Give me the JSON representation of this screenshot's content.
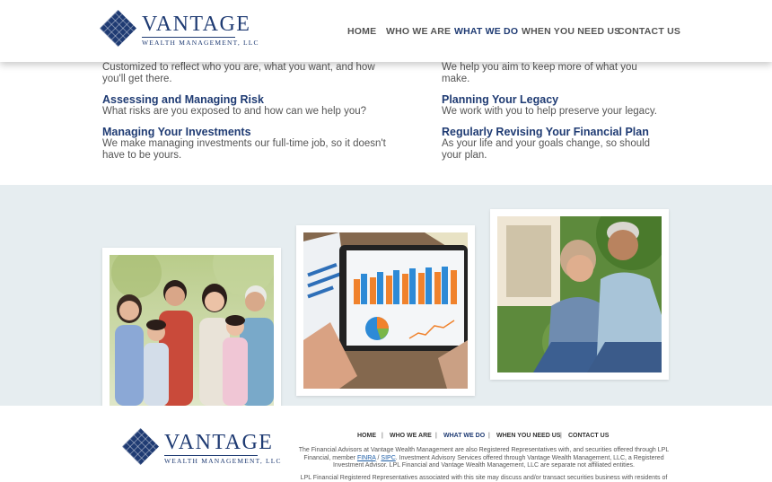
{
  "brand": {
    "name": "VANTAGE",
    "tagline": "WEALTH MANAGEMENT, LLC",
    "color": "#1f3b73"
  },
  "nav": {
    "items": [
      {
        "label": "HOME",
        "active": false
      },
      {
        "label": "WHO WE ARE",
        "active": false
      },
      {
        "label": "WHAT WE DO",
        "active": true
      },
      {
        "label": "WHEN YOU NEED US",
        "active": false
      },
      {
        "label": "CONTACT US",
        "active": false
      }
    ]
  },
  "services": {
    "left": [
      {
        "title": "",
        "desc": "Customized to reflect who you are, what you want, and how you'll get there."
      },
      {
        "title": "Assessing and Managing Risk",
        "desc": "What risks are you exposed to and how can we help you?"
      },
      {
        "title": "Managing Your Investments",
        "desc": "We make managing investments our full-time job, so it doesn't have to be yours."
      }
    ],
    "right": [
      {
        "title": "",
        "desc": "We help you aim to keep more of what you make."
      },
      {
        "title": "Planning Your Legacy",
        "desc": "We work with you to help preserve your legacy."
      },
      {
        "title": "Regularly Revising Your Financial Plan",
        "desc": "As your life and your goals change, so should your plan."
      }
    ]
  },
  "photos": [
    {
      "icon": "family-photo"
    },
    {
      "icon": "tablet-chart-photo"
    },
    {
      "icon": "couple-photo"
    }
  ],
  "footer": {
    "nav": [
      "HOME",
      "WHO WE ARE",
      "WHAT WE DO",
      "WHEN YOU NEED US",
      "CONTACT US"
    ],
    "active": "WHAT WE DO",
    "separator": "|",
    "disclosure_1a": "The Financial Advisors at Vantage Wealth Management are also Registered Representatives with, and securities offered through LPL Financial, member ",
    "finra": "FINRA",
    "slash": " / ",
    "sipc": "SIPC",
    "disclosure_1b": ". Investment Advisory Services offered through Vantage Wealth Management, LLC, a Registered Investment Advisor. LPL Financial and Vantage Wealth Management, LLC are separate not affiliated entities.",
    "disclosure_2": "LPL Financial Registered Representatives associated with this site may discuss and/or transact securities business with residents of the"
  }
}
